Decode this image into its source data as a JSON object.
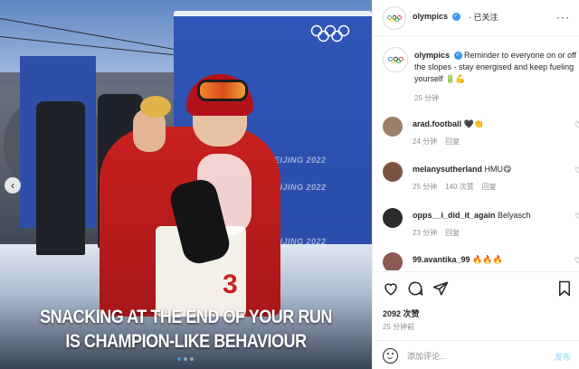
{
  "post": {
    "image_caption_line1": "SNACKING AT THE END OF YOUR RUN",
    "image_caption_line2": "IS CHAMPION-LIKE BEHAVIOUR",
    "banner_text": "BEIJING 2022",
    "bib_number": "3",
    "carousel": {
      "total": 3,
      "active_index": 0
    }
  },
  "header": {
    "username": "olympics",
    "follow_status": "· 已关注",
    "more_label": "···"
  },
  "caption": {
    "username": "olympics",
    "text": "Reminder to everyone on or off the slopes - stay energised and keep fueling yourself 🔋💪",
    "time": "25 分钟"
  },
  "comments": [
    {
      "username": "arad.football",
      "text": "🖤👏",
      "time": "24 分钟",
      "likes": "",
      "reply": "回复",
      "avatar_color": "#9a7f6a"
    },
    {
      "username": "melanysutherland",
      "text": "HMU😋",
      "time": "25 分钟",
      "likes": "140 次赞",
      "reply": "回复",
      "avatar_color": "#7a5440"
    },
    {
      "username": "opps__i_did_it_again",
      "text": "Belyasch",
      "time": "23 分钟",
      "likes": "",
      "reply": "回复",
      "avatar_color": "#2b2b2b"
    },
    {
      "username": "99.avantika_99",
      "text": "🔥🔥🔥",
      "time": "",
      "likes": "",
      "reply": "",
      "avatar_color": "#8c5a52"
    }
  ],
  "actions": {
    "likes_count": "2092 次赞",
    "post_time": "25 分钟前"
  },
  "add_comment": {
    "placeholder": "添加评论...",
    "post_label": "发布"
  },
  "colors": {
    "accent": "#3897f0",
    "wall_blue": "#2a4aa6",
    "jacket_red": "#c8201e"
  }
}
